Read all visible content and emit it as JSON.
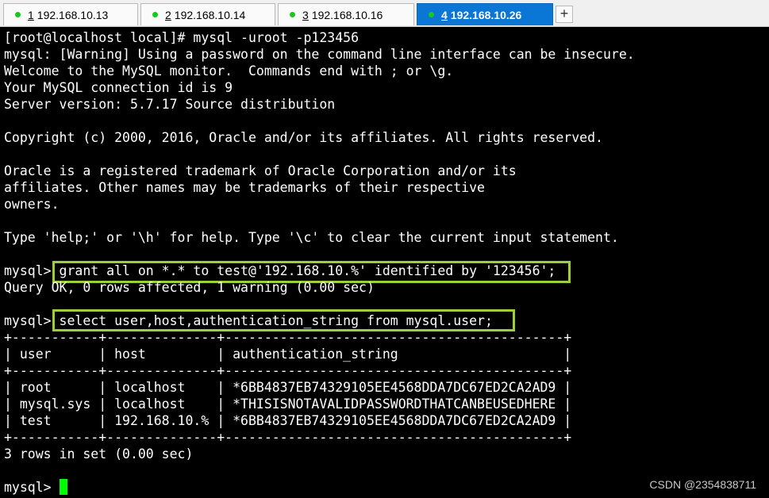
{
  "tabs": [
    {
      "num": "1",
      "host": " 192.168.10.13",
      "active": false
    },
    {
      "num": "2",
      "host": " 192.168.10.14",
      "active": false
    },
    {
      "num": "3",
      "host": " 192.168.10.16",
      "active": false
    },
    {
      "num": "4",
      "host": " 192.168.10.26",
      "active": true
    }
  ],
  "add_tab": "+",
  "status_dot_color": "#19c81e",
  "highlight_color": "#9bd03b",
  "cursor_color": "#00ff00",
  "terminal": {
    "lines": [
      "[root@localhost local]# mysql -uroot -p123456",
      "mysql: [Warning] Using a password on the command line interface can be insecure.",
      "Welcome to the MySQL monitor.  Commands end with ; or \\g.",
      "Your MySQL connection id is 9",
      "Server version: 5.7.17 Source distribution",
      "",
      "Copyright (c) 2000, 2016, Oracle and/or its affiliates. All rights reserved.",
      "",
      "Oracle is a registered trademark of Oracle Corporation and/or its",
      "affiliates. Other names may be trademarks of their respective",
      "owners.",
      "",
      "Type 'help;' or '\\h' for help. Type '\\c' to clear the current input statement.",
      "",
      "mysql> grant all on *.* to test@'192.168.10.%' identified by '123456';",
      "Query OK, 0 rows affected, 1 warning (0.00 sec)",
      "",
      "mysql> select user,host,authentication_string from mysql.user;",
      "+-----------+--------------+-------------------------------------------+",
      "| user      | host         | authentication_string                     |",
      "+-----------+--------------+-------------------------------------------+",
      "| root      | localhost    | *6BB4837EB74329105EE4568DDA7DC67ED2CA2AD9 |",
      "| mysql.sys | localhost    | *THISISNOTAVALIDPASSWORDTHATCANBEUSEDHERE |",
      "| test      | 192.168.10.% | *6BB4837EB74329105EE4568DDA7DC67ED2CA2AD9 |",
      "+-----------+--------------+-------------------------------------------+",
      "3 rows in set (0.00 sec)",
      "",
      "mysql> "
    ]
  },
  "watermark": "CSDN @2354838711"
}
